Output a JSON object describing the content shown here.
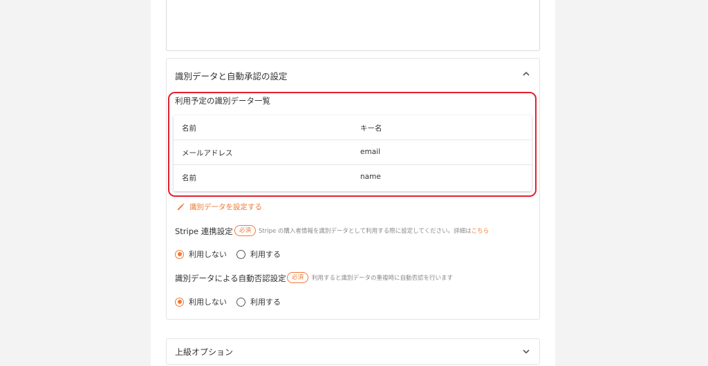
{
  "panel": {
    "title": "識別データと自動承認の設定",
    "list_title": "利用予定の識別データ一覧",
    "table": {
      "headers": [
        "名前",
        "キー名"
      ],
      "rows": [
        [
          "メールアドレス",
          "email"
        ],
        [
          "名前",
          "name"
        ]
      ]
    },
    "edit_link": "識別データを設定する",
    "stripe": {
      "label": "Stripe 連携設定",
      "badge": "必須",
      "hint": "Stripe の購入者情報を識別データとして利用する際に設定してください。詳細は",
      "hint_link": "こちら",
      "options": [
        "利用しない",
        "利用する"
      ],
      "selected": "利用しない"
    },
    "auto": {
      "label": "識別データによる自動否認設定",
      "badge": "必須",
      "hint": "利用すると識別データの重複時に自動否認を行います",
      "options": [
        "利用しない",
        "利用する"
      ],
      "selected": "利用しない"
    }
  },
  "advanced": {
    "title": "上級オプション"
  },
  "colors": {
    "accent": "#ef7a35",
    "highlight": "#e0202e"
  }
}
